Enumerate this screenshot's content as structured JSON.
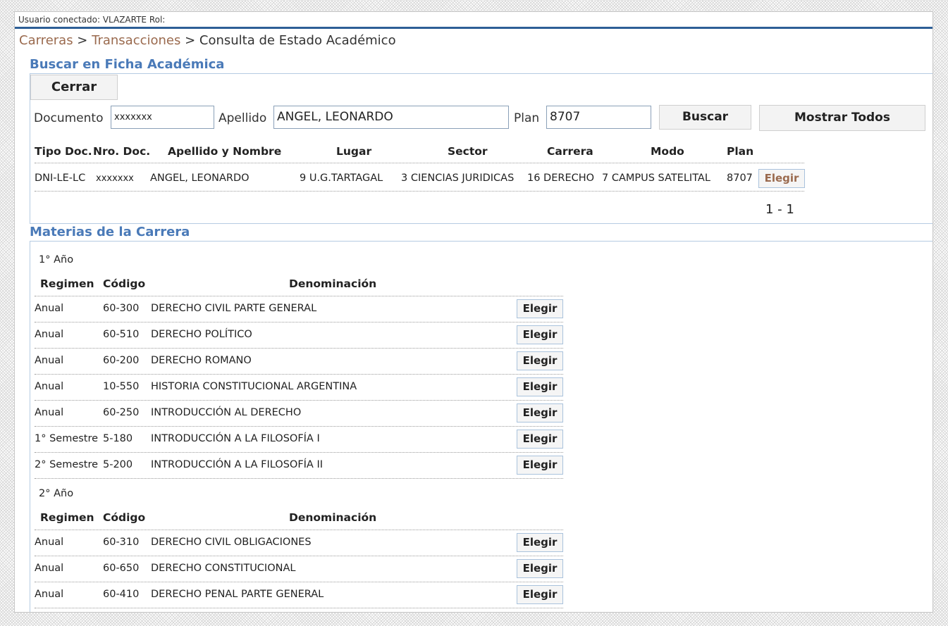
{
  "user_bar": {
    "label": "Usuario conectado: VLAZARTE Rol:"
  },
  "breadcrumb": {
    "item1": "Carreras",
    "sep1": " > ",
    "item2": "Transacciones",
    "sep2": " > ",
    "current": "Consulta de Estado Académico"
  },
  "search_section": {
    "title": "Buscar en Ficha Académica",
    "close_button": "Cerrar",
    "documento_label": "Documento",
    "documento_value": "xxxxxxx",
    "apellido_label": "Apellido",
    "apellido_value": "ANGEL,  LEONARDO",
    "plan_label": "Plan",
    "plan_value": "8707",
    "search_button": "Buscar",
    "show_all_button": "Mostrar Todos",
    "results_headers": [
      "Tipo Doc.",
      "Nro. Doc.",
      "Apellido y Nombre",
      "Lugar",
      "Sector",
      "Carrera",
      "Modo",
      "Plan"
    ],
    "result_row": {
      "tipo_doc": "DNI-LE-LC",
      "nro_doc": "xxxxxxx",
      "nombre": "ANGEL, LEONARDO",
      "lugar": "9 U.G.TARTAGAL",
      "sector": "3 CIENCIAS JURIDICAS",
      "carrera": "16 DERECHO",
      "modo": "7 CAMPUS SATELITAL",
      "plan": "8707",
      "action": "Elegir"
    },
    "pagination": "1 - 1"
  },
  "subjects_section": {
    "title": "Materias de la Carrera",
    "headers": {
      "regimen": "Regimen",
      "codigo": "Código",
      "denominacion": "Denominación"
    },
    "action_label": "Elegir",
    "years": [
      {
        "label": "1° Año",
        "rows": [
          {
            "regimen": "Anual",
            "codigo": "60-300",
            "denominacion": "DERECHO CIVIL PARTE GENERAL"
          },
          {
            "regimen": "Anual",
            "codigo": "60-510",
            "denominacion": "DERECHO POLÍTICO"
          },
          {
            "regimen": "Anual",
            "codigo": "60-200",
            "denominacion": "DERECHO ROMANO"
          },
          {
            "regimen": "Anual",
            "codigo": "10-550",
            "denominacion": "HISTORIA CONSTITUCIONAL ARGENTINA"
          },
          {
            "regimen": "Anual",
            "codigo": "60-250",
            "denominacion": "INTRODUCCIÓN AL DERECHO"
          },
          {
            "regimen": "1° Semestre",
            "codigo": "5-180",
            "denominacion": "INTRODUCCIÓN A LA FILOSOFÍA I"
          },
          {
            "regimen": "2° Semestre",
            "codigo": "5-200",
            "denominacion": "INTRODUCCIÓN A LA FILOSOFÍA II"
          }
        ]
      },
      {
        "label": "2° Año",
        "rows": [
          {
            "regimen": "Anual",
            "codigo": "60-310",
            "denominacion": "DERECHO CIVIL OBLIGACIONES"
          },
          {
            "regimen": "Anual",
            "codigo": "60-650",
            "denominacion": "DERECHO CONSTITUCIONAL"
          },
          {
            "regimen": "Anual",
            "codigo": "60-410",
            "denominacion": "DERECHO PENAL PARTE GENERAL"
          }
        ]
      }
    ]
  }
}
